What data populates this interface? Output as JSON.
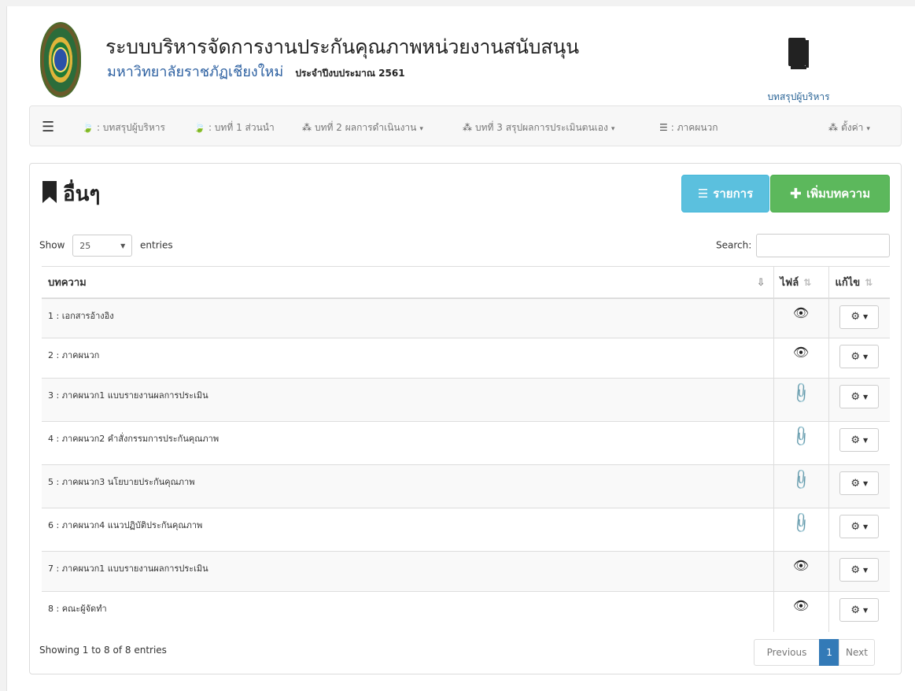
{
  "header": {
    "title": "ระบบบริหารจัดการงานประกันคุณภาพหน่วยงานสนับสนุน",
    "university": "มหาวิทยาลัยราชภัฏเชียงใหม่",
    "fiscal_year": "ประจำปีงบประมาณ 2561",
    "exec_summary_label": "บทสรุปผู้บริหาร"
  },
  "nav": {
    "items": [
      {
        "label": ": บทสรุปผู้บริหาร",
        "icon": "leaf-icon"
      },
      {
        "label": ": บทที่ 1 ส่วนนำ",
        "icon": "leaf-icon"
      },
      {
        "label": "บทที่ 2 ผลการดำเนินงาน",
        "icon": "sitemap-icon",
        "caret": "▾"
      },
      {
        "label": "บทที่ 3 สรุปผลการประเมินตนเอง",
        "icon": "sitemap-icon",
        "caret": "▾"
      },
      {
        "label": ": ภาคผนวก",
        "icon": "list-icon"
      }
    ],
    "settings_label": "ตั้งค่า"
  },
  "panel": {
    "title": "อื่นๆ",
    "list_button": "รายการ",
    "add_button": "เพิ่มบทความ",
    "show_label": "Show",
    "entries_value": "25",
    "entries_label": "entries",
    "search_label": "Search:",
    "search_value": ""
  },
  "table": {
    "headers": [
      "บทความ",
      "ไฟล์",
      "แก้ไข"
    ],
    "rows": [
      {
        "name": "1 : เอกสารอ้างอิง",
        "file": "hidden"
      },
      {
        "name": "2 : ภาคผนวก",
        "file": "hidden"
      },
      {
        "name": "3 : ภาคผนวก1 แบบรายงานผลการประเมิน",
        "file": "attachment"
      },
      {
        "name": "4 : ภาคผนวก2 คำสั่งกรรมการประกันคุณภาพ",
        "file": "attachment"
      },
      {
        "name": "5 : ภาคผนวก3 นโยบายประกันคุณภาพ",
        "file": "attachment"
      },
      {
        "name": "6 : ภาคผนวก4 แนวปฏิบัติประกันคุณภาพ",
        "file": "attachment"
      },
      {
        "name": "7 : ภาคผนวก1 แบบรายงานผลการประเมิน",
        "file": "hidden"
      },
      {
        "name": "8 : คณะผู้จัดทำ",
        "file": "hidden"
      }
    ]
  },
  "footer": {
    "info": "Showing 1 to 8 of 8 entries",
    "prev": "Previous",
    "current_page": "1",
    "next": "Next"
  },
  "colors": {
    "info_button": "#5bc0de",
    "success_button": "#5cb85c",
    "primary": "#337ab7",
    "attachment_icon": "#4a90c2"
  }
}
